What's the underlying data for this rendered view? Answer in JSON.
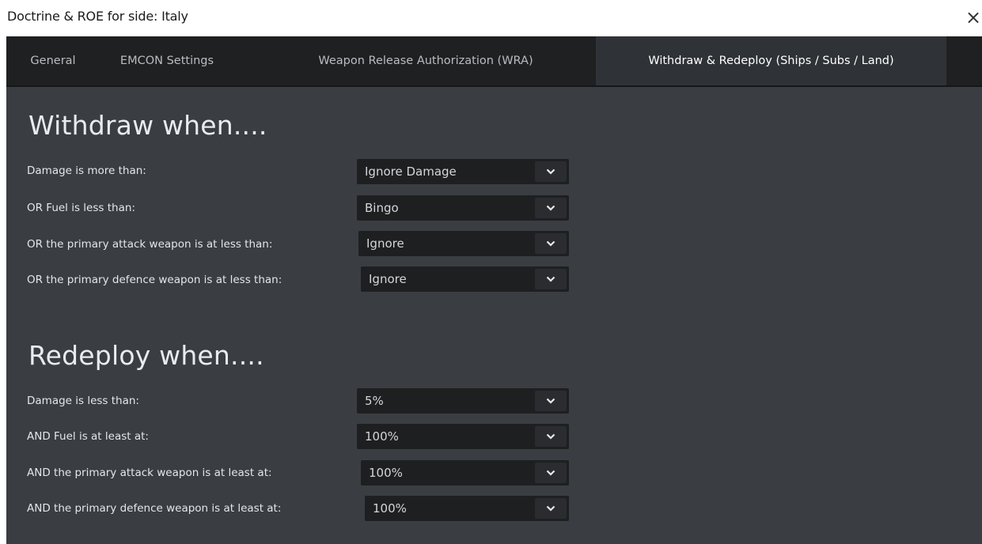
{
  "window": {
    "title": "Doctrine & ROE for side: Italy",
    "close_glyph": "×"
  },
  "tabs": [
    {
      "label": "General"
    },
    {
      "label": "EMCON Settings"
    },
    {
      "label": "Weapon Release Authorization (WRA)"
    },
    {
      "label": "Withdraw & Redeploy (Ships / Subs / Land)",
      "active": true
    }
  ],
  "withdraw": {
    "title": "Withdraw when....",
    "rows": [
      {
        "label": "Damage is more than:",
        "value": "Ignore Damage"
      },
      {
        "label": "OR Fuel is less than:",
        "value": "Bingo"
      },
      {
        "label": "OR the primary attack weapon is at less than:",
        "value": "Ignore"
      },
      {
        "label": "OR the primary defence weapon is at less than:",
        "value": "Ignore"
      }
    ]
  },
  "redeploy": {
    "title": "Redeploy when....",
    "rows": [
      {
        "label": "Damage is less than:",
        "value": "5%"
      },
      {
        "label": "AND Fuel is at least at:",
        "value": "100%"
      },
      {
        "label": "AND the primary attack weapon is at least at:",
        "value": "100%"
      },
      {
        "label": "AND the primary defence weapon is at least at:",
        "value": "100%"
      }
    ]
  },
  "icons": {
    "close": "close-icon",
    "dropdown": "chevron-down-icon"
  },
  "colors": {
    "panel_bg": "#3a3d42",
    "tab_bar_bg": "#1f2021",
    "active_tab_bg": "#2f3236",
    "select_bg": "#1e1f21"
  }
}
